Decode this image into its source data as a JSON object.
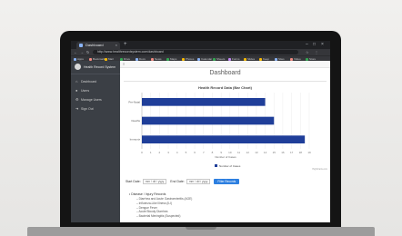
{
  "browser": {
    "tab_title": "Dashboard",
    "tab_close": "×",
    "new_tab": "+",
    "url": "http://www.healthrecordsystem.com/dashboard",
    "controls": {
      "minimize": "–",
      "maximize": "□",
      "close": "×"
    },
    "nav_icons": [
      "back-icon",
      "forward-icon",
      "reload-icon"
    ],
    "bookmarks": [
      {
        "label": "Apps",
        "color": "#8ab4f8"
      },
      {
        "label": "Bookmarks",
        "color": "#f28b82"
      },
      {
        "label": "Mail",
        "color": "#fbbc04"
      },
      {
        "label": "Drive",
        "color": "#34a853"
      },
      {
        "label": "Docs",
        "color": "#8ab4f8"
      },
      {
        "label": "News",
        "color": "#f28b82"
      },
      {
        "label": "Maps",
        "color": "#34a853"
      },
      {
        "label": "Photos",
        "color": "#fbbc04"
      },
      {
        "label": "Calendar",
        "color": "#8ab4f8"
      },
      {
        "label": "Sheets",
        "color": "#34a853"
      },
      {
        "label": "Forms",
        "color": "#c58af9"
      },
      {
        "label": "Slides",
        "color": "#fbbc04"
      },
      {
        "label": "Keep",
        "color": "#fbbc04"
      },
      {
        "label": "Sites",
        "color": "#8ab4f8"
      },
      {
        "label": "Video",
        "color": "#f28b82"
      },
      {
        "label": "Store",
        "color": "#34a853"
      }
    ]
  },
  "sidebar": {
    "brand": "Health Record System",
    "items": [
      {
        "label": "Dashboard",
        "icon": "home-icon"
      },
      {
        "label": "Users",
        "icon": "users-icon"
      },
      {
        "label": "Manage Users",
        "icon": "user-settings-icon"
      },
      {
        "label": "Sign Out",
        "icon": "sign-out-icon"
      }
    ]
  },
  "header": {
    "menu_icon": "≡"
  },
  "main": {
    "page_title": "Dashboard"
  },
  "chart_data": {
    "type": "bar",
    "orientation": "horizontal",
    "title": "Health Record Data (Bar Chart)",
    "categories": [
      "Pre-Natal",
      "Deaths",
      "Immuniz"
    ],
    "values": [
      14,
      15,
      18.5
    ],
    "xlim": [
      0,
      19
    ],
    "x_ticks": [
      0,
      1,
      2,
      3,
      4,
      5,
      6,
      7,
      8,
      9,
      10,
      11,
      12,
      13,
      14,
      15,
      16,
      17,
      18,
      19
    ],
    "xlabel": "Number of Cases",
    "legend": "Number of Cases",
    "legend_position": "bottom",
    "color": "#1f3e99",
    "credit": "Highcharts.com"
  },
  "filters": {
    "start_label": "Start Date:",
    "start_value": "mm / dd / yyyy",
    "end_label": "End Date:",
    "end_value": "mm / dd / yyyy",
    "button_label": "Filter Records"
  },
  "list": {
    "title": "Disease / Injury Records",
    "items": [
      "Diarrhea and Acute Gastroenteritis (AGE)",
      "Influenza-Like Illness (ILI)",
      "Dengue Fever",
      "Acute Bloody Diarrhea",
      "Bacterial Meningitis (Suspected)"
    ]
  }
}
